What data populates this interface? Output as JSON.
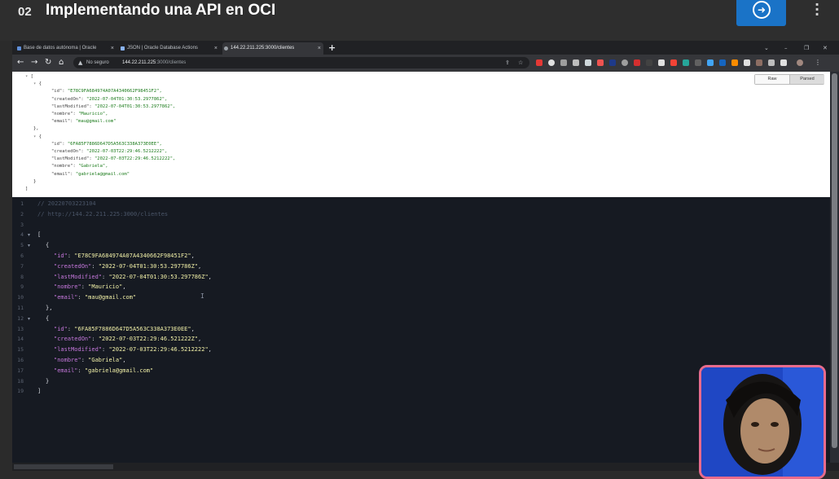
{
  "course": {
    "lesson_number": "02",
    "lesson_title": "Implementando una API en OCI",
    "next_icon": "arrow-right-circle-icon",
    "menu_icon": "kebab-menu-icon"
  },
  "browser": {
    "tabs": [
      {
        "label": "Base de datos autónoma | Oracle",
        "active": false
      },
      {
        "label": "JSON | Oracle Database Actions",
        "active": false
      },
      {
        "label": "144.22.211.225:3000/clientes",
        "active": true
      }
    ],
    "close_glyph": "×",
    "new_tab_glyph": "+",
    "window_controls": [
      "⌄",
      "–",
      "❐",
      "✕"
    ],
    "nav": {
      "back": "←",
      "forward": "→",
      "reload": "↻",
      "home": "⌂"
    },
    "security_label": "No seguro",
    "url_host": "144.22.211.225",
    "url_path": ":3000/clientes"
  },
  "viewer": {
    "raw_label": "Raw",
    "parsed_label": "Parsed"
  },
  "raw_lines": [
    {
      "indent": 0,
      "tri": "▾",
      "text": "["
    },
    {
      "indent": 1,
      "tri": "▾",
      "text": "{"
    },
    {
      "indent": 2,
      "key": "\"id\"",
      "val": "\"E78C9FA684974A07A4340662F98451F2\","
    },
    {
      "indent": 2,
      "key": "\"createdOn\"",
      "val": "\"2022-07-04T01:30:53.2977862\","
    },
    {
      "indent": 2,
      "key": "\"lastModified\"",
      "val": "\"2022-07-04T01:30:53.2977862\","
    },
    {
      "indent": 2,
      "key": "\"nombre\"",
      "val": "\"Mauricio\","
    },
    {
      "indent": 2,
      "key": "\"email\"",
      "val": "\"mau@gmail.com\""
    },
    {
      "indent": 1,
      "text": "},"
    },
    {
      "indent": 1,
      "tri": "▾",
      "text": "{"
    },
    {
      "indent": 2,
      "key": "\"id\"",
      "val": "\"6FA85F7886D647D5A563C338A373E0EE\","
    },
    {
      "indent": 2,
      "key": "\"createdOn\"",
      "val": "\"2022-07-03T22:29:46.5212222\","
    },
    {
      "indent": 2,
      "key": "\"lastModified\"",
      "val": "\"2022-07-03T22:29:46.5212222\","
    },
    {
      "indent": 2,
      "key": "\"nombre\"",
      "val": "\"Gabriela\","
    },
    {
      "indent": 2,
      "key": "\"email\"",
      "val": "\"gabriela@gmail.com\""
    },
    {
      "indent": 1,
      "text": "}"
    },
    {
      "indent": 0,
      "text": "]"
    }
  ],
  "editor_lines": [
    {
      "n": "1",
      "type": "comment",
      "text": "// 20220703223104"
    },
    {
      "n": "2",
      "type": "comment",
      "text": "// http://144.22.211.225:3000/clientes"
    },
    {
      "n": "3",
      "type": "blank",
      "text": ""
    },
    {
      "n": "4",
      "fold": "▾",
      "indent": 0,
      "type": "punct",
      "text": "["
    },
    {
      "n": "5",
      "fold": "▾",
      "indent": 1,
      "type": "punct",
      "text": "{"
    },
    {
      "n": "6",
      "indent": 2,
      "type": "pair",
      "key": "\"id\"",
      "val": "\"E78C9FA684974A07A4340662F98451F2\"",
      "end": ","
    },
    {
      "n": "7",
      "indent": 2,
      "type": "pair",
      "key": "\"createdOn\"",
      "val": "\"2022-07-04T01:30:53.297786Z\"",
      "end": ","
    },
    {
      "n": "8",
      "indent": 2,
      "type": "pair",
      "key": "\"lastModified\"",
      "val": "\"2022-07-04T01:30:53.297786Z\"",
      "end": ","
    },
    {
      "n": "9",
      "indent": 2,
      "type": "pair",
      "key": "\"nombre\"",
      "val": "\"Mauricio\"",
      "end": ","
    },
    {
      "n": "10",
      "indent": 2,
      "type": "pair",
      "key": "\"email\"",
      "val": "\"mau@gmail.com\"",
      "end": ""
    },
    {
      "n": "11",
      "indent": 1,
      "type": "punct",
      "text": "},"
    },
    {
      "n": "12",
      "fold": "▾",
      "indent": 1,
      "type": "punct",
      "text": "{"
    },
    {
      "n": "13",
      "indent": 2,
      "type": "pair",
      "key": "\"id\"",
      "val": "\"6FA85F7886D647D5A563C338A373E0EE\"",
      "end": ","
    },
    {
      "n": "14",
      "indent": 2,
      "type": "pair",
      "key": "\"createdOn\"",
      "val": "\"2022-07-03T22:29:46.521222Z\"",
      "end": ","
    },
    {
      "n": "15",
      "indent": 2,
      "type": "pair",
      "key": "\"lastModified\"",
      "val": "\"2022-07-03T22:29:46.5212222\"",
      "end": ","
    },
    {
      "n": "16",
      "indent": 2,
      "type": "pair",
      "key": "\"nombre\"",
      "val": "\"Gabriela\"",
      "end": ","
    },
    {
      "n": "17",
      "indent": 2,
      "type": "pair",
      "key": "\"email\"",
      "val": "\"gabriela@gmail.com\"",
      "end": ""
    },
    {
      "n": "18",
      "indent": 1,
      "type": "punct",
      "text": "}"
    },
    {
      "n": "19",
      "indent": 0,
      "type": "punct",
      "text": "]"
    }
  ],
  "colors": {
    "accent": "#1a73c7",
    "editor_bg": "#161a22",
    "json_key": "#c678dd",
    "json_string": "#f2f1a8",
    "webcam_border": "#e86b8c"
  }
}
